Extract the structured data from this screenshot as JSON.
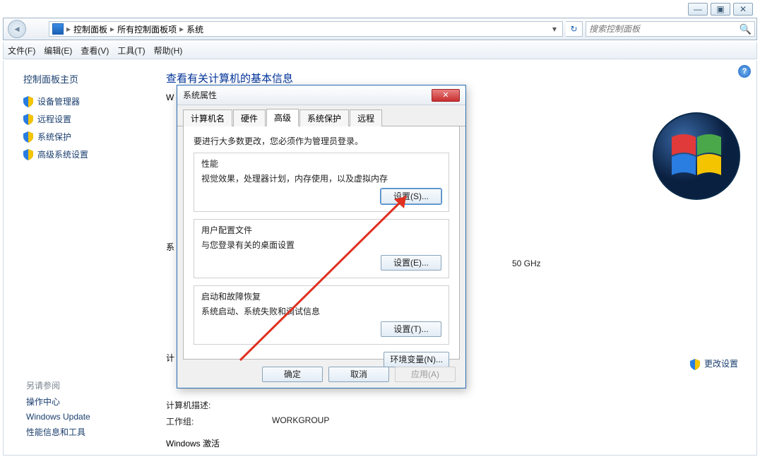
{
  "win_ctrl": {
    "min": "—",
    "max": "▣",
    "close": "✕"
  },
  "breadcrumb": {
    "items": [
      "控制面板",
      "所有控制面板项",
      "系统"
    ],
    "sep": "▸",
    "dd": "▾"
  },
  "refresh_glyph": "↻",
  "search": {
    "placeholder": "搜索控制面板",
    "icon": "🔍"
  },
  "menu": {
    "file": "文件(F)",
    "edit": "编辑(E)",
    "view": "查看(V)",
    "tools": "工具(T)",
    "help": "帮助(H)"
  },
  "sidebar": {
    "title": "控制面板主页",
    "links": [
      "设备管理器",
      "远程设置",
      "系统保护",
      "高级系统设置"
    ],
    "see_also_title": "另请参阅",
    "see_also": [
      "操作中心",
      "Windows Update",
      "性能信息和工具"
    ]
  },
  "content": {
    "heading": "查看有关计算机的基本信息",
    "partial1": "W",
    "partial2": "系",
    "partial3": "计",
    "ghz": "50 GHz",
    "desc_lbl": "计算机描述:",
    "wg_lbl": "工作组:",
    "wg_val": "WORKGROUP",
    "activate": "Windows 激活",
    "change_link": "更改设置",
    "help": "?"
  },
  "dialog": {
    "title": "系统属性",
    "tabs": [
      "计算机名",
      "硬件",
      "高级",
      "系统保护",
      "远程"
    ],
    "active_tab": 2,
    "note": "要进行大多数更改，您必须作为管理员登录。",
    "groups": {
      "perf": {
        "title": "性能",
        "desc": "视觉效果，处理器计划，内存使用，以及虚拟内存",
        "btn": "设置(S)..."
      },
      "prof": {
        "title": "用户配置文件",
        "desc": "与您登录有关的桌面设置",
        "btn": "设置(E)..."
      },
      "boot": {
        "title": "启动和故障恢复",
        "desc": "系统启动、系统失败和调试信息",
        "btn": "设置(T)..."
      }
    },
    "env_btn": "环境变量(N)...",
    "footer": {
      "ok": "确定",
      "cancel": "取消",
      "apply": "应用(A)"
    },
    "close_glyph": "✕"
  }
}
